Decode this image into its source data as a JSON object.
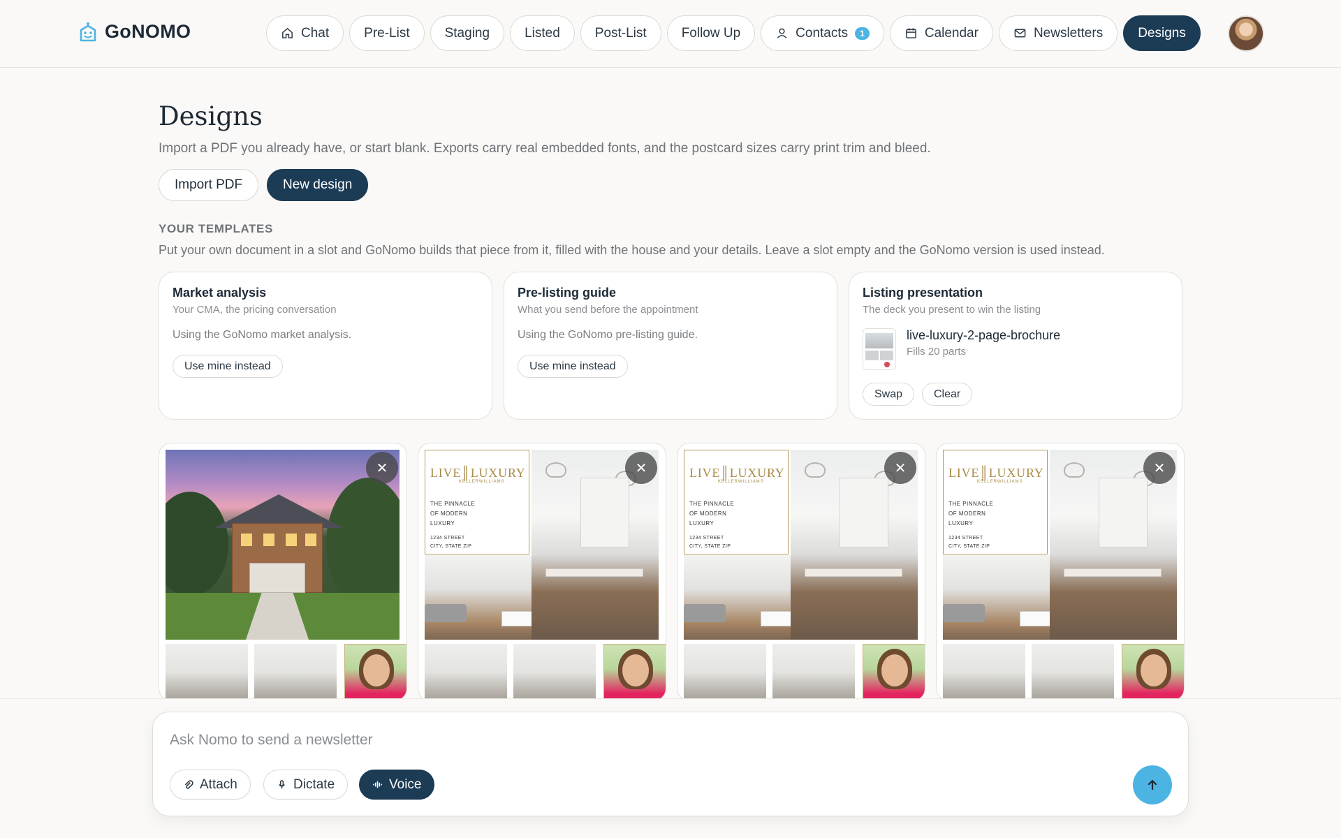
{
  "brand": {
    "name": "GoNOMO"
  },
  "nav": {
    "items": [
      {
        "label": "Chat",
        "icon": "home-icon"
      },
      {
        "label": "Pre-List"
      },
      {
        "label": "Staging"
      },
      {
        "label": "Listed"
      },
      {
        "label": "Post-List"
      },
      {
        "label": "Follow Up"
      },
      {
        "label": "Contacts",
        "icon": "user-icon",
        "badge": "1"
      },
      {
        "label": "Calendar",
        "icon": "calendar-icon"
      },
      {
        "label": "Newsletters",
        "icon": "mail-icon"
      },
      {
        "label": "Designs",
        "active": true
      }
    ]
  },
  "page": {
    "title": "Designs",
    "subtitle": "Import a PDF you already have, or start blank. Exports carry real embedded fonts, and the postcard sizes carry print trim and bleed.",
    "import_label": "Import PDF",
    "new_label": "New design"
  },
  "templates": {
    "heading": "YOUR TEMPLATES",
    "description": "Put your own document in a slot and GoNomo builds that piece from it, filled with the house and your details. Leave a slot empty and the GoNomo version is used instead.",
    "slots": [
      {
        "title": "Market analysis",
        "subtitle": "Your CMA, the pricing conversation",
        "status": "Using the GoNomo market analysis.",
        "action": "Use mine instead"
      },
      {
        "title": "Pre-listing guide",
        "subtitle": "What you send before the appointment",
        "status": "Using the GoNomo pre-listing guide.",
        "action": "Use mine instead"
      },
      {
        "title": "Listing presentation",
        "subtitle": "The deck you present to win the listing",
        "file_name": "live-luxury-2-page-brochure",
        "file_info": "Fills 20 parts",
        "swap": "Swap",
        "clear": "Clear"
      }
    ]
  },
  "designs": {
    "close_glyph": "✕",
    "brochure": {
      "logo_left": "LIVE",
      "logo_right": "LUXURY",
      "logo_sub": "KELLERWILLIAMS",
      "line1": "THE PINNACLE",
      "line2": "OF MODERN",
      "line3": "LUXURY",
      "street": "1234 STREET",
      "city": "CITY, STATE ZIP"
    }
  },
  "composer": {
    "placeholder": "Ask Nomo to send a newsletter",
    "attach": "Attach",
    "dictate": "Dictate",
    "voice": "Voice"
  },
  "colors": {
    "accent": "#1c3b55",
    "highlight": "#4cb4e3",
    "gold": "#a98a45"
  }
}
